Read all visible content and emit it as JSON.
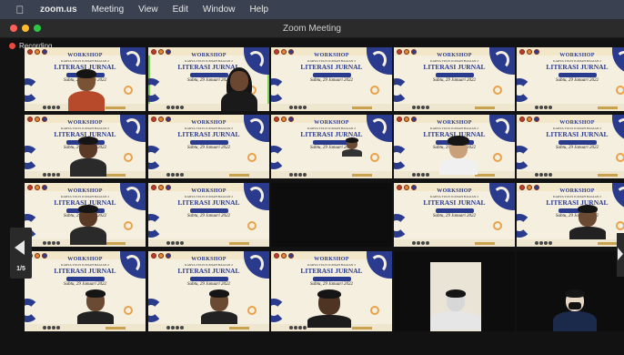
{
  "menubar": {
    "apple_icon": "apple-logo",
    "app_name": "zoom.us",
    "items": [
      "Meeting",
      "View",
      "Edit",
      "Window",
      "Help"
    ]
  },
  "window": {
    "title": "Zoom Meeting"
  },
  "recording": {
    "label": "Recording"
  },
  "slide": {
    "workshop": "WORKSHOP",
    "subtitle": "KARYA TULIS ILMIAH BAGIAN 2",
    "literasi": "LITERASI JURNAL",
    "date": "Sabtu, 29 Januari 2022"
  },
  "pager": {
    "page": "1/5"
  },
  "colors": {
    "recording_dot": "#e84a3c",
    "active_speaker_border": "#7bd34f",
    "slide_blue": "#2a3a8c"
  }
}
